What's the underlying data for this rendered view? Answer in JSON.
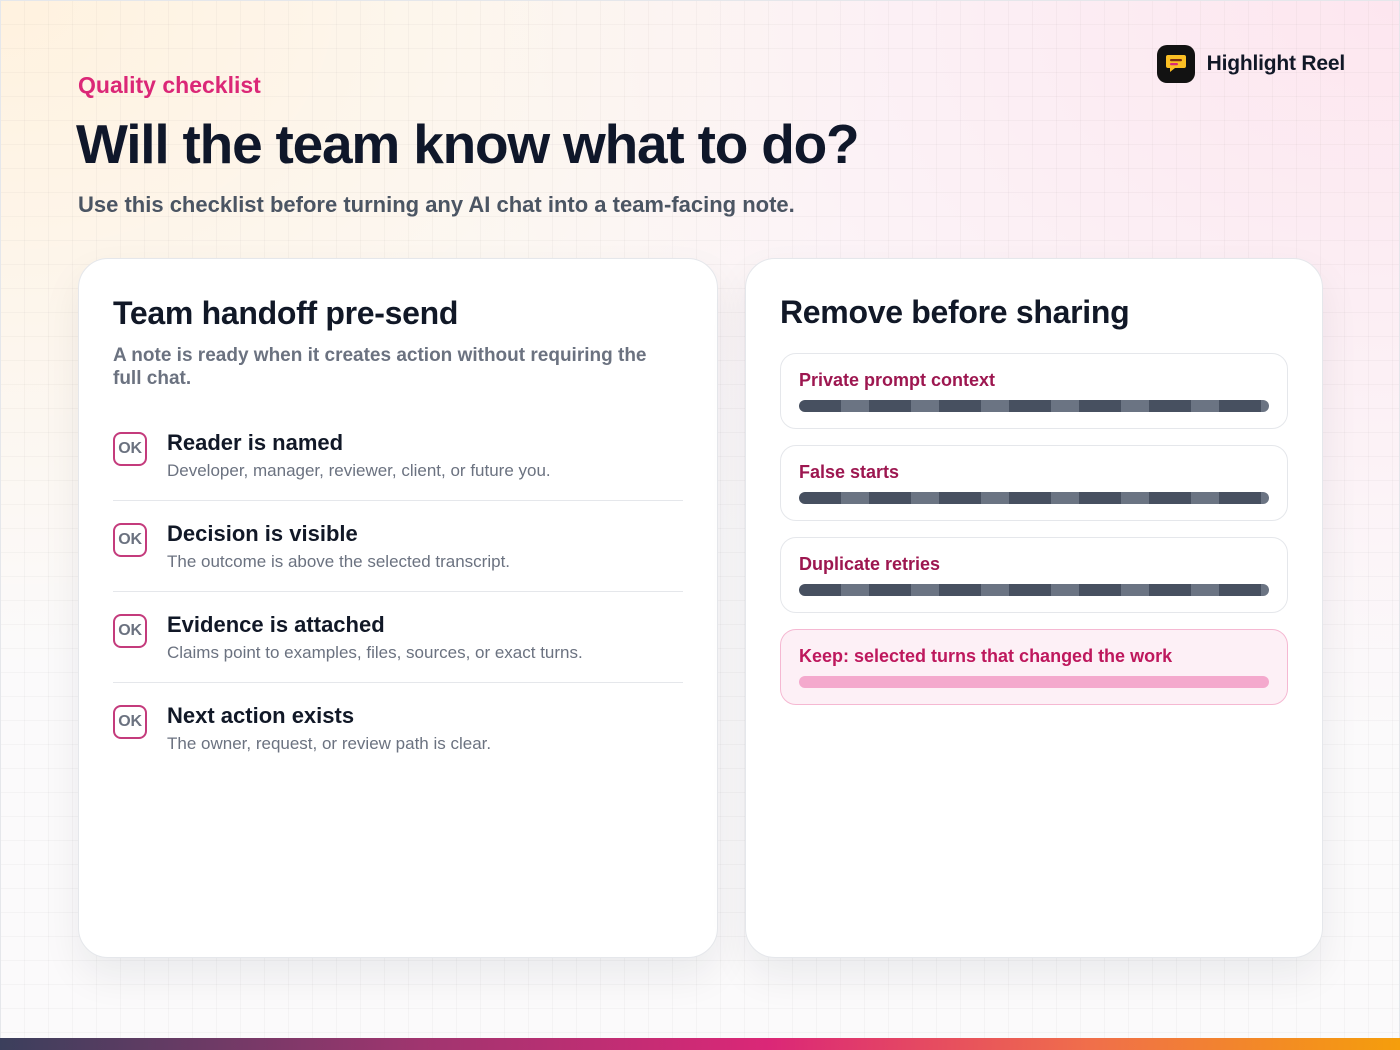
{
  "brand": {
    "name": "Highlight Reel",
    "icon": "chat-bubble-icon"
  },
  "header": {
    "eyebrow": "Quality checklist",
    "title": "Will the team know what to do?",
    "subtitle": "Use this checklist before turning any AI chat into a team-facing note."
  },
  "handoff": {
    "title": "Team handoff pre-send",
    "description": "A note is ready when it creates action without requiring the full chat.",
    "items": [
      {
        "badge": "OK",
        "title": "Reader is named",
        "description": "Developer, manager, reviewer, client, or future you."
      },
      {
        "badge": "OK",
        "title": "Decision is visible",
        "description": "The outcome is above the selected transcript."
      },
      {
        "badge": "OK",
        "title": "Evidence is attached",
        "description": "Claims point to examples, files, sources, or exact turns."
      },
      {
        "badge": "OK",
        "title": "Next action exists",
        "description": "The owner, request, or review path is clear."
      }
    ]
  },
  "remove": {
    "title": "Remove before sharing",
    "items": [
      {
        "label": "Private prompt context"
      },
      {
        "label": "False starts"
      },
      {
        "label": "Duplicate retries"
      }
    ],
    "keep": {
      "label": "Keep: selected turns that changed the work"
    }
  },
  "colors": {
    "accent": "#db2777",
    "remove_label": "#9d1750",
    "redaction_dark": "#475060",
    "redaction_light": "#6b7483",
    "keep_bar": "#f4a9cd"
  }
}
